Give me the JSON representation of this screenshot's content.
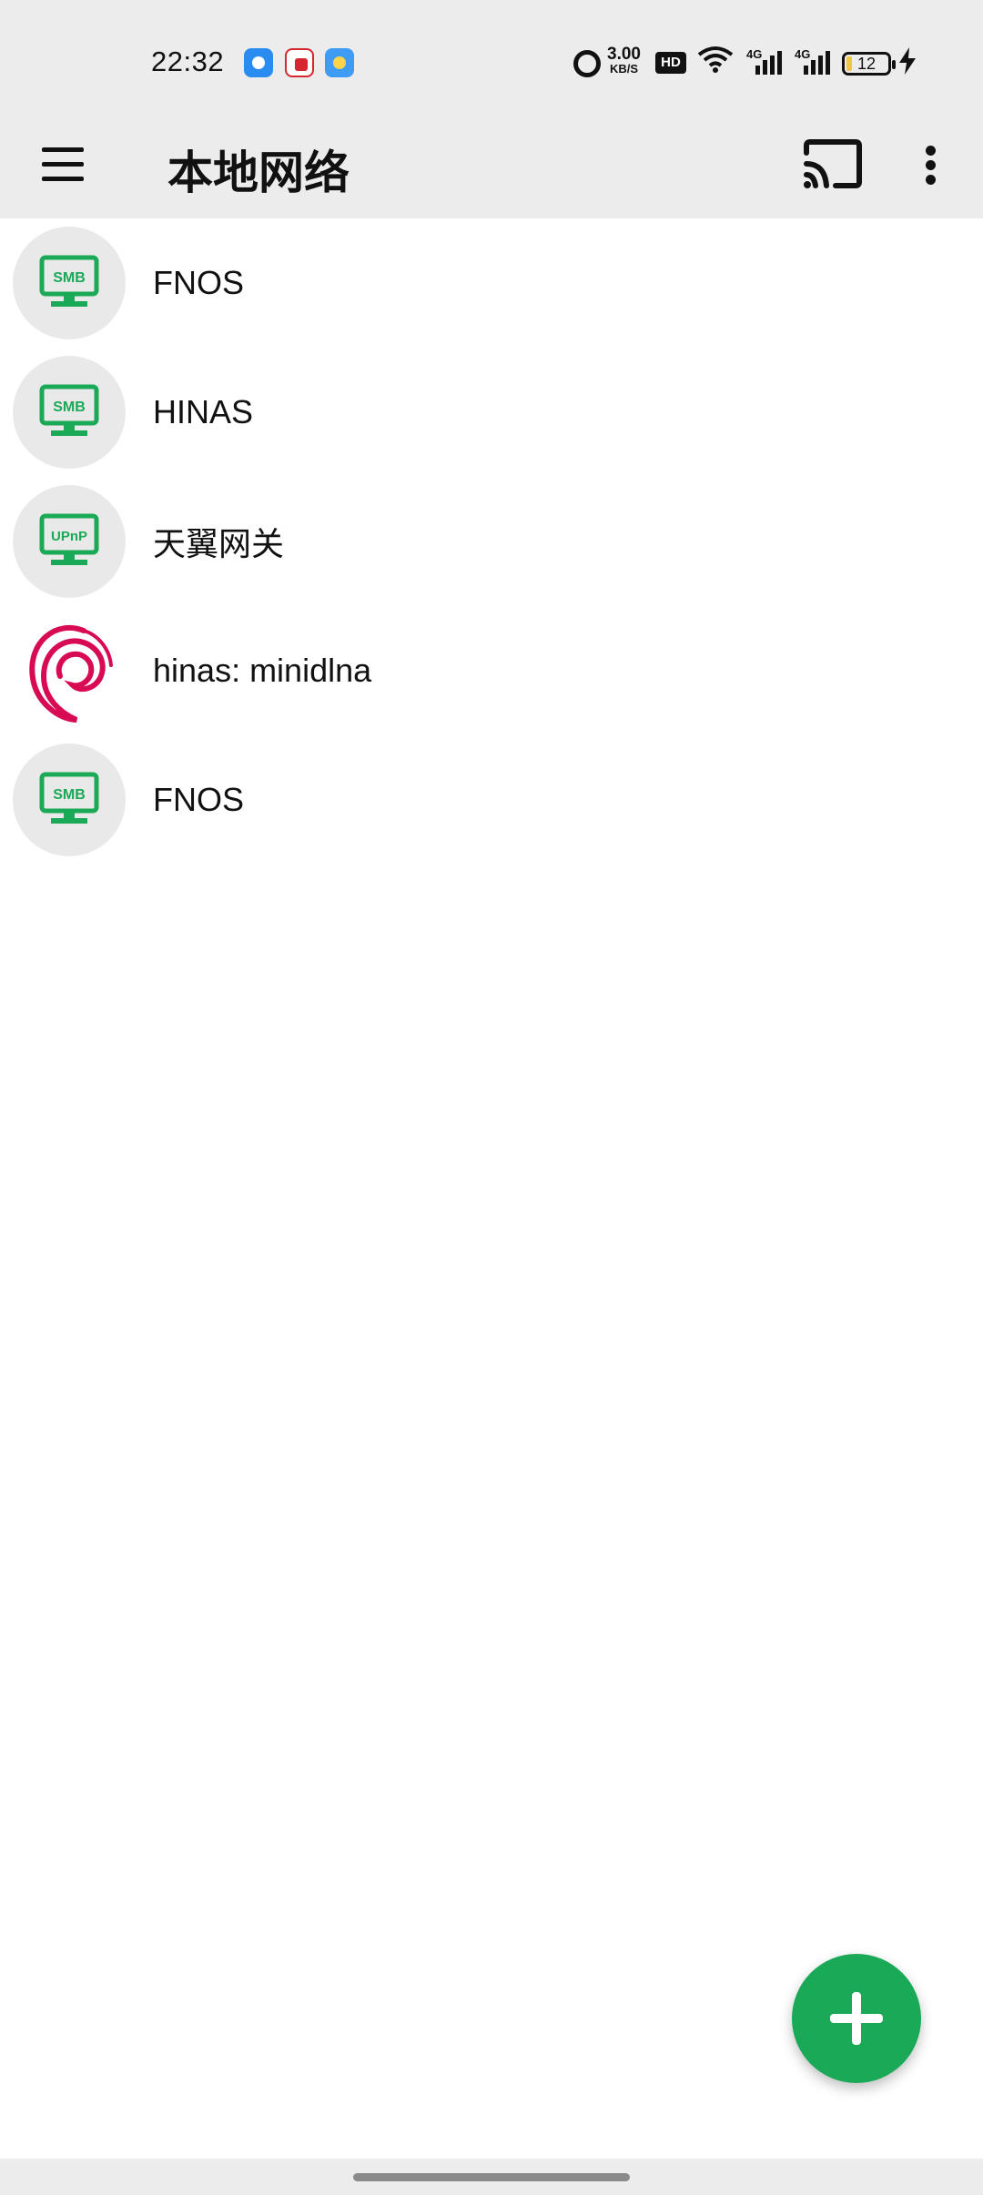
{
  "status_bar": {
    "time": "22:32",
    "net_speed_value": "3.00",
    "net_speed_unit": "KB/S",
    "hd_badge": "HD",
    "signal_1_label": "4G",
    "signal_2_label": "4G",
    "battery_level": "12",
    "notification_icons": [
      "location-app-icon",
      "home-app-icon",
      "weather-app-icon"
    ]
  },
  "app_bar": {
    "title": "本地网络"
  },
  "devices": [
    {
      "badge": "SMB",
      "label": "FNOS",
      "icon": "monitor-smb-icon"
    },
    {
      "badge": "SMB",
      "label": "HINAS",
      "icon": "monitor-smb-icon"
    },
    {
      "badge": "UPnP",
      "label": "天翼网关",
      "icon": "monitor-upnp-icon"
    },
    {
      "badge": "",
      "label": "hinas: minidlna",
      "icon": "debian-swirl-icon"
    },
    {
      "badge": "SMB",
      "label": "FNOS",
      "icon": "monitor-smb-icon"
    }
  ],
  "colors": {
    "accent_green": "#1aa957",
    "bar_background": "#ececec",
    "debian_red": "#d70a53"
  }
}
